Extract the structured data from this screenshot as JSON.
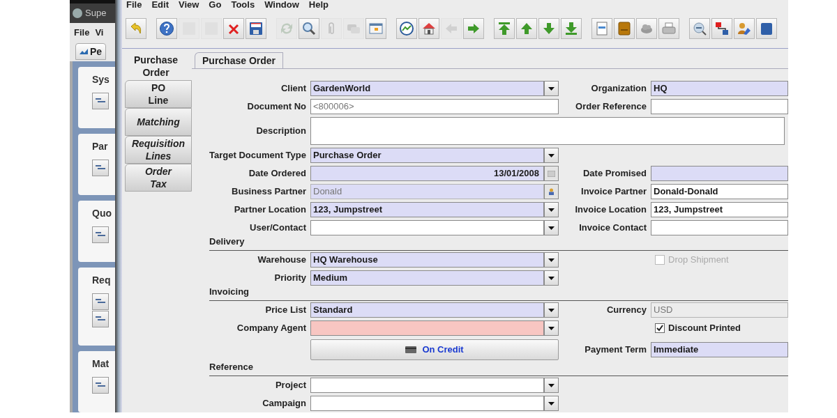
{
  "background_window": {
    "title": "Supe",
    "menu": [
      "File",
      "Vi"
    ],
    "tab": "Pe",
    "panels": [
      {
        "title": "Sys",
        "kind": "single"
      },
      {
        "title": "Par",
        "kind": "single"
      },
      {
        "title": "Quo",
        "kind": "single"
      },
      {
        "title": "Req",
        "kind": "double"
      },
      {
        "title": "Mat",
        "kind": "single"
      }
    ]
  },
  "menu": [
    "File",
    "Edit",
    "View",
    "Go",
    "Tools",
    "Window",
    "Help"
  ],
  "toolbar_groups": [
    [
      {
        "disabled": false
      }
    ],
    [
      {
        "disabled": false
      },
      {
        "disabled": true
      },
      {
        "disabled": true
      },
      {
        "disabled": false
      },
      {
        "disabled": false
      }
    ],
    [
      {
        "disabled": true
      },
      {
        "disabled": false
      },
      {
        "disabled": true
      },
      {
        "disabled": true
      },
      {
        "disabled": false
      }
    ],
    [
      {
        "disabled": false
      },
      {
        "disabled": false
      },
      {
        "disabled": true
      },
      {
        "disabled": false
      }
    ],
    [
      {
        "disabled": false
      },
      {
        "disabled": false
      },
      {
        "disabled": false
      },
      {
        "disabled": false
      }
    ],
    [
      {
        "disabled": false
      },
      {
        "disabled": false
      },
      {
        "disabled": false
      },
      {
        "disabled": false
      }
    ],
    [
      {
        "disabled": false
      },
      {
        "disabled": false
      },
      {
        "disabled": false
      },
      {
        "disabled": false
      }
    ]
  ],
  "side_tabs": [
    {
      "label": "Purchase Order",
      "selected": true,
      "italic": false
    },
    {
      "label": "PO Line",
      "selected": false,
      "italic": false
    },
    {
      "label": "Matching",
      "selected": false,
      "italic": true
    },
    {
      "label": "Requisition Lines",
      "selected": false,
      "italic": true
    },
    {
      "label": "Order Tax",
      "selected": false,
      "italic": true
    }
  ],
  "tabs": [
    {
      "label": "Purchase Order",
      "selected": true
    }
  ],
  "form_rows": [
    {
      "kind": "field",
      "left": {
        "label": "Client",
        "kind": "combo",
        "value": "GardenWorld",
        "mandatory": true,
        "readonly": false,
        "error": false
      },
      "right": {
        "label": "Organization",
        "kind": "text",
        "value": "HQ",
        "mandatory": true,
        "readonly": false,
        "error": false
      }
    },
    {
      "kind": "field",
      "left": {
        "label": "Document No",
        "kind": "text",
        "placeholder": "<800006>",
        "mandatory": false,
        "readonly": false,
        "error": false
      },
      "right": {
        "label": "Order Reference",
        "kind": "text",
        "mandatory": false,
        "readonly": false,
        "error": false
      }
    },
    {
      "kind": "wide",
      "left": {
        "label": "Description",
        "kind": "textarea",
        "mandatory": false,
        "readonly": false,
        "error": false
      }
    },
    {
      "kind": "field",
      "left": {
        "label": "Target Document Type",
        "kind": "combo",
        "value": "Purchase Order",
        "mandatory": true,
        "readonly": false,
        "error": false
      }
    },
    {
      "kind": "field",
      "left": {
        "label": "Date Ordered",
        "kind": "date",
        "value": "13/01/2008",
        "mandatory": true,
        "readonly": false,
        "error": false
      },
      "right": {
        "label": "Date Promised",
        "kind": "text",
        "mandatory": true,
        "readonly": false,
        "error": false
      }
    },
    {
      "kind": "field",
      "left": {
        "label": "Business Partner",
        "kind": "search",
        "value": "Donald",
        "mandatory": true,
        "readonly": true,
        "error": false
      },
      "right": {
        "label": "Invoice Partner",
        "kind": "text",
        "value": "Donald-Donald",
        "mandatory": false,
        "readonly": false,
        "error": false
      }
    },
    {
      "kind": "field",
      "left": {
        "label": "Partner Location",
        "kind": "combo",
        "value": "123, Jumpstreet",
        "mandatory": true,
        "readonly": false,
        "error": false
      },
      "right": {
        "label": "Invoice Location",
        "kind": "text",
        "value": "123, Jumpstreet",
        "mandatory": false,
        "readonly": false,
        "error": false
      }
    },
    {
      "kind": "field",
      "left": {
        "label": "User/Contact",
        "kind": "combo",
        "mandatory": false,
        "readonly": false,
        "error": false
      },
      "right": {
        "label": "Invoice Contact",
        "kind": "text",
        "mandatory": false,
        "readonly": false,
        "error": false
      }
    },
    {
      "kind": "section",
      "title": "Delivery"
    },
    {
      "kind": "field",
      "left": {
        "label": "Warehouse",
        "kind": "combo",
        "value": "HQ Warehouse",
        "mandatory": true,
        "readonly": false,
        "error": false
      },
      "right": {
        "kind": "checkbox",
        "label": "Drop Shipment",
        "checked": false,
        "disabled": true
      }
    },
    {
      "kind": "field",
      "left": {
        "label": "Priority",
        "kind": "combo",
        "value": "Medium",
        "mandatory": true,
        "readonly": false,
        "error": false
      }
    },
    {
      "kind": "section",
      "title": "Invoicing"
    },
    {
      "kind": "field",
      "left": {
        "label": "Price List",
        "kind": "combo",
        "value": "Standard",
        "mandatory": true,
        "readonly": false,
        "error": false
      },
      "right": {
        "label": "Currency",
        "kind": "text",
        "value": "USD",
        "mandatory": false,
        "readonly": true,
        "error": false
      }
    },
    {
      "kind": "field",
      "left": {
        "label": "Company Agent",
        "kind": "combo",
        "mandatory": true,
        "readonly": false,
        "error": true
      },
      "right": {
        "kind": "checkbox",
        "label": "Discount Printed",
        "checked": true,
        "disabled": false
      }
    },
    {
      "kind": "button",
      "left": {
        "kind": "button",
        "label": "On Credit"
      },
      "right": {
        "label": "Payment Term",
        "kind": "text",
        "value": "Immediate",
        "mandatory": true,
        "readonly": false,
        "error": false
      }
    },
    {
      "kind": "section",
      "title": "Reference"
    },
    {
      "kind": "field",
      "left": {
        "label": "Project",
        "kind": "combo",
        "mandatory": false,
        "readonly": false,
        "error": false
      }
    },
    {
      "kind": "field",
      "left": {
        "label": "Campaign",
        "kind": "combo",
        "mandatory": false,
        "readonly": false,
        "error": false
      }
    }
  ]
}
